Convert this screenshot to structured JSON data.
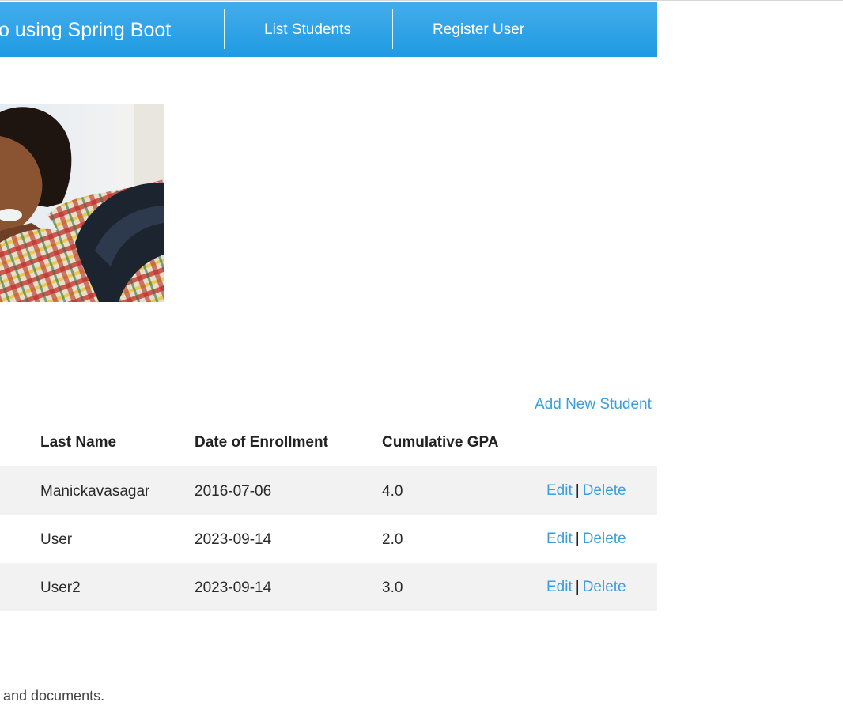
{
  "navbar": {
    "brand": "o using Spring Boot",
    "links": [
      {
        "label": "List Students"
      },
      {
        "label": "Register User"
      }
    ],
    "color": "#2a9fe6"
  },
  "hero": {
    "image": "student-photo"
  },
  "toolbar": {
    "add_label": "Add New Student"
  },
  "table": {
    "columns": [
      "Last Name",
      "Date of Enrollment",
      "Cumulative GPA"
    ],
    "rows": [
      {
        "last_name": "Manickavasagar",
        "enrolled": "2016-07-06",
        "gpa": "4.0",
        "edit": "Edit",
        "sep": "|",
        "delete": "Delete"
      },
      {
        "last_name": "User",
        "enrolled": "2023-09-14",
        "gpa": "2.0",
        "edit": "Edit",
        "sep": "|",
        "delete": "Delete"
      },
      {
        "last_name": "User2",
        "enrolled": "2023-09-14",
        "gpa": "3.0",
        "edit": "Edit",
        "sep": "|",
        "delete": "Delete"
      }
    ]
  },
  "footer": {
    "text": "and documents."
  },
  "colors": {
    "link": "#3a9fdc",
    "stripe": "#f2f2f2"
  }
}
